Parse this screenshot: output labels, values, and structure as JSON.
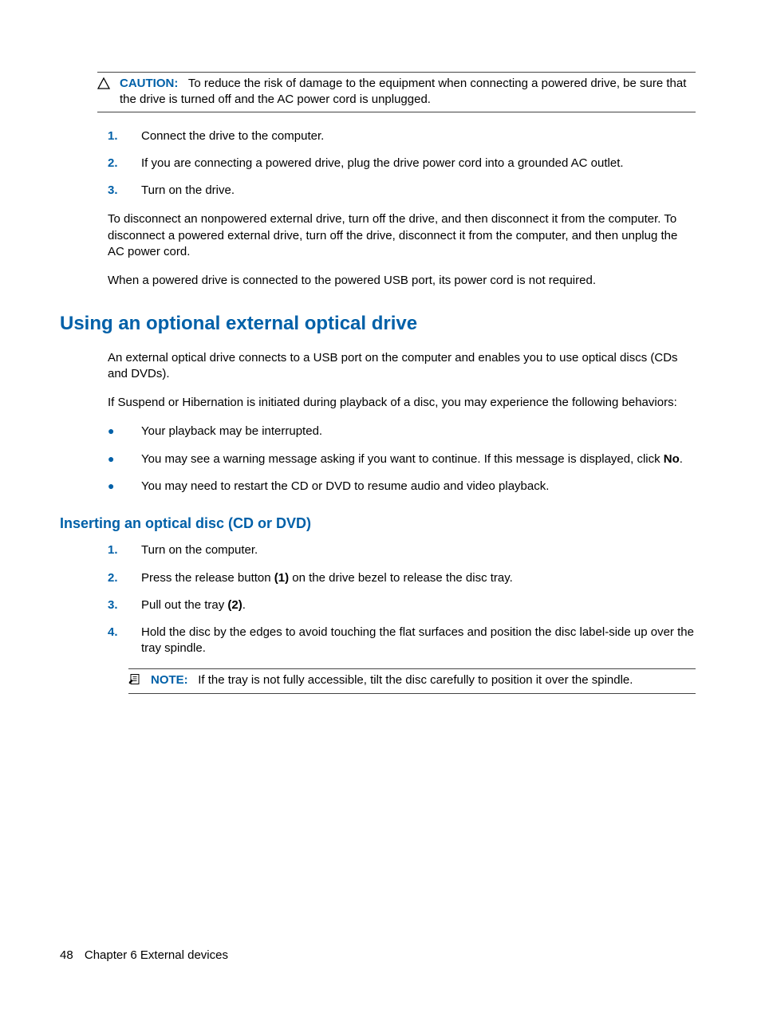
{
  "caution": {
    "label": "CAUTION:",
    "text": "To reduce the risk of damage to the equipment when connecting a powered drive, be sure that the drive is turned off and the AC power cord is unplugged."
  },
  "steps1": [
    "Connect the drive to the computer.",
    "If you are connecting a powered drive, plug the drive power cord into a grounded AC outlet.",
    "Turn on the drive."
  ],
  "para1": "To disconnect an nonpowered external drive, turn off the drive, and then disconnect it from the computer. To disconnect a powered external drive, turn off the drive, disconnect it from the computer, and then unplug the AC power cord.",
  "para2": "When a powered drive is connected to the powered USB port, its power cord is not required.",
  "h1": "Using an optional external optical drive",
  "para3": "An external optical drive connects to a USB port on the computer and enables you to use optical discs (CDs and DVDs).",
  "para4": "If Suspend or Hibernation is initiated during playback of a disc, you may experience the following behaviors:",
  "bullets": {
    "b1": "Your playback may be interrupted.",
    "b2a": "You may see a warning message asking if you want to continue. If this message is displayed, click ",
    "b2b": "No",
    "b2c": ".",
    "b3": "You may need to restart the CD or DVD to resume audio and video playback."
  },
  "h2": "Inserting an optical disc (CD or DVD)",
  "steps2": {
    "s1": "Turn on the computer.",
    "s2a": "Press the release button ",
    "s2b": "(1)",
    "s2c": " on the drive bezel to release the disc tray.",
    "s3a": "Pull out the tray ",
    "s3b": "(2)",
    "s3c": ".",
    "s4": "Hold the disc by the edges to avoid touching the flat surfaces and position the disc label-side up over the tray spindle."
  },
  "note": {
    "label": "NOTE:",
    "text": "If the tray is not fully accessible, tilt the disc carefully to position it over the spindle."
  },
  "footer": {
    "page": "48",
    "chapter": "Chapter 6   External devices"
  },
  "nums": {
    "n1": "1.",
    "n2": "2.",
    "n3": "3.",
    "n4": "4."
  }
}
